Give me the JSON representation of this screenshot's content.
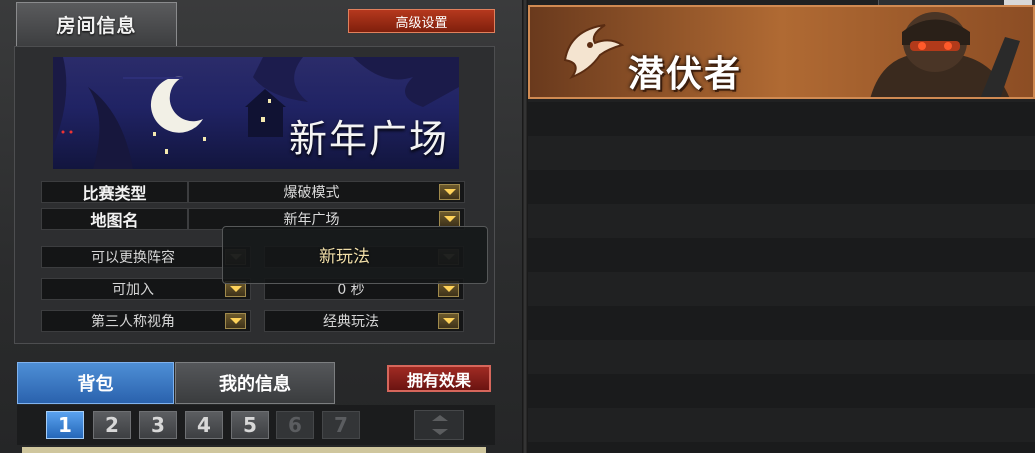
{
  "room": {
    "title": "房间信息",
    "advanced_settings": "高级设置",
    "map_title": "新年广场",
    "match_type_label": "比赛类型",
    "match_type_value": "爆破模式",
    "map_name_label": "地图名",
    "map_name_value": "新年广场"
  },
  "options": {
    "change_lineup": "可以更换阵容",
    "joinable": "可加入",
    "third_person": "第三人称视角",
    "timer": "0 秒",
    "play_style": "经典玩法",
    "tooltip": "新玩法"
  },
  "tabs": {
    "bag": "背包",
    "my_info": "我的信息",
    "effects": "拥有效果"
  },
  "pages": [
    "1",
    "2",
    "3",
    "4",
    "5",
    "6",
    "7"
  ],
  "active_page": "1",
  "banner": {
    "text": "潜伏者"
  },
  "colors": {
    "accent_blue": "#2a62ad",
    "accent_red": "#9a2f22",
    "banner_orange": "#b06a33",
    "dropdown_gold": "#ffd35a"
  }
}
